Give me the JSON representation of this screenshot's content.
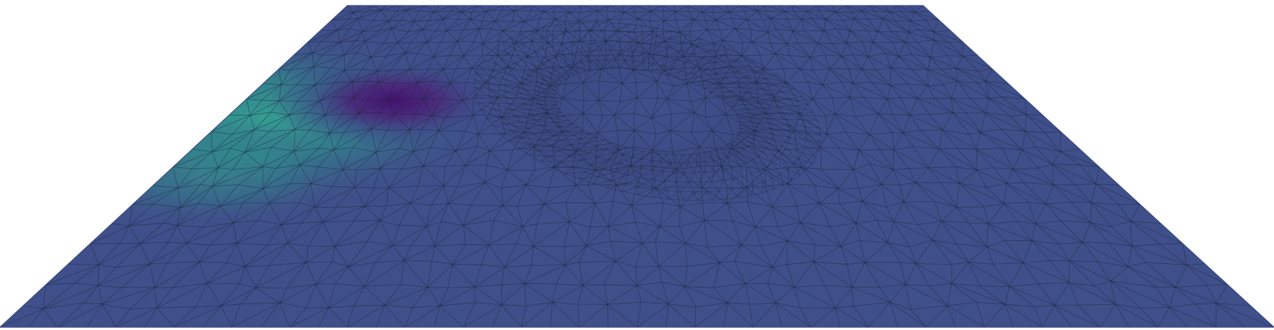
{
  "scene": {
    "background_color": "#ffffff",
    "surface_base_color": "#3f4f8a",
    "surface_edge_color": "#3a4a82",
    "wireframe_color": "#1b2236",
    "colormap": {
      "low": "#3f4f8a",
      "mid": "#2f8d8c",
      "high": "#3f1f6e"
    }
  }
}
